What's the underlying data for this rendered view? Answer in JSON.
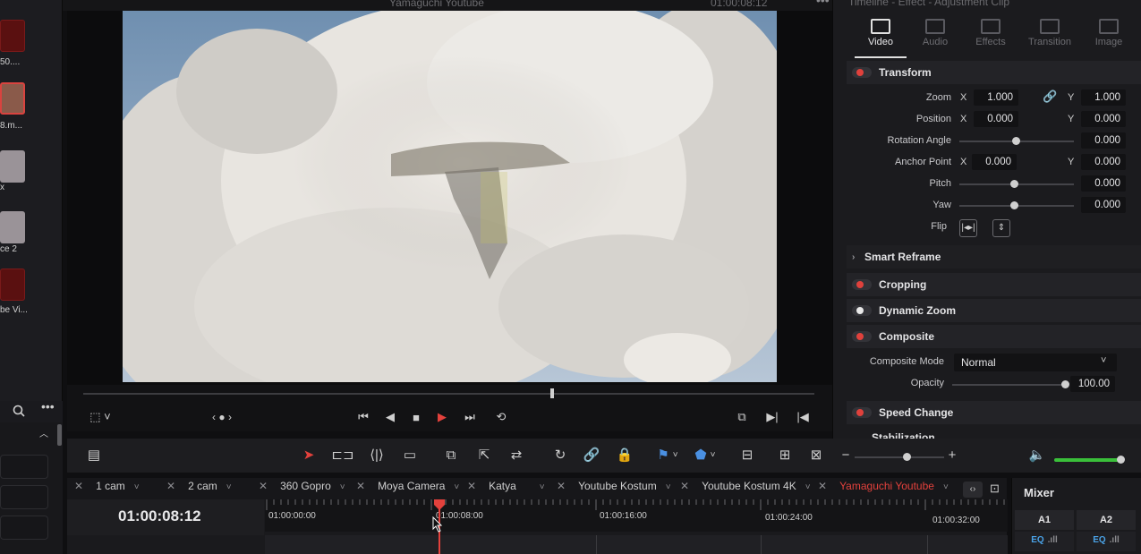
{
  "media_pool": {
    "items": [
      {
        "label": "50...."
      },
      {
        "label": "8.m..."
      },
      {
        "label": "x"
      },
      {
        "label": "ce 2"
      },
      {
        "label": "be Vi..."
      }
    ]
  },
  "viewer": {
    "title": "Yamaguchi Youtube",
    "timecode": "01:00:08:12"
  },
  "inspector": {
    "title": "Timeline - Effect - Adjustment Clip",
    "tabs": [
      {
        "label": "Video",
        "icon": "film-icon"
      },
      {
        "label": "Audio",
        "icon": "music-note-icon"
      },
      {
        "label": "Effects",
        "icon": "magic-wand-icon"
      },
      {
        "label": "Transition",
        "icon": "transition-icon"
      },
      {
        "label": "Image",
        "icon": "image-icon"
      }
    ],
    "transform": {
      "label": "Transform",
      "zoom": {
        "label": "Zoom",
        "x": "1.000",
        "y": "1.000"
      },
      "position": {
        "label": "Position",
        "x": "0.000",
        "y": "0.000"
      },
      "rotation": {
        "label": "Rotation Angle",
        "value": "0.000"
      },
      "anchor": {
        "label": "Anchor Point",
        "x": "0.000",
        "y": "0.000"
      },
      "pitch": {
        "label": "Pitch",
        "value": "0.000"
      },
      "yaw": {
        "label": "Yaw",
        "value": "0.000"
      },
      "flip": {
        "label": "Flip"
      },
      "x_axis": "X",
      "y_axis": "Y"
    },
    "smart_reframe": "Smart Reframe",
    "cropping": "Cropping",
    "dynamic_zoom": "Dynamic Zoom",
    "composite": {
      "label": "Composite",
      "mode_label": "Composite Mode",
      "mode_value": "Normal",
      "opacity_label": "Opacity",
      "opacity_value": "100.00"
    },
    "speed_change": "Speed Change",
    "stabilization": "Stabilization"
  },
  "timeline_tabs": [
    {
      "label": "1 cam"
    },
    {
      "label": "2 cam"
    },
    {
      "label": "360 Gopro"
    },
    {
      "label": "Moya Camera"
    },
    {
      "label": "Katya"
    },
    {
      "label": "Youtube Kostum"
    },
    {
      "label": "Youtube Kostum 4K"
    },
    {
      "label": "Yamaguchi Youtube"
    }
  ],
  "timeline": {
    "timecode": "01:00:08:12",
    "ruler": [
      "01:00:00:00",
      "01:00:08:00",
      "01:00:16:00",
      "01:00:24:00",
      "01:00:32:00"
    ]
  },
  "mixer": {
    "title": "Mixer",
    "channels": [
      {
        "name": "A1",
        "eq": "EQ"
      },
      {
        "name": "A2",
        "eq": "EQ"
      }
    ]
  },
  "colors": {
    "accent_red": "#e3413c",
    "volume_green": "#3ac03a",
    "eq_blue": "#4aa3e8"
  }
}
